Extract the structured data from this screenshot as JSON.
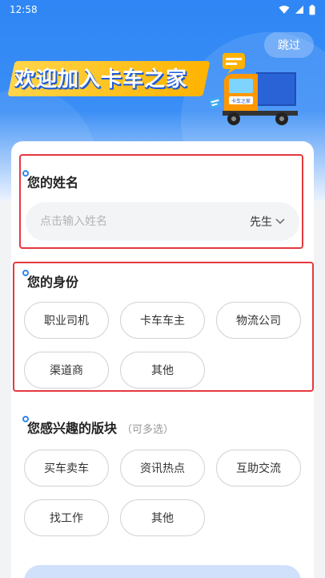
{
  "status": {
    "time": "12:58"
  },
  "header": {
    "skip_label": "跳过",
    "title": "欢迎加入卡车之家",
    "truck_label": "卡车之家"
  },
  "name_section": {
    "title": "您的姓名",
    "placeholder": "点击输入姓名",
    "salutation": "先生"
  },
  "identity_section": {
    "title": "您的身份",
    "options": [
      "职业司机",
      "卡车车主",
      "物流公司",
      "渠道商",
      "其他"
    ]
  },
  "interest_section": {
    "title": "您感兴趣的版块",
    "hint": "（可多选）",
    "options": [
      "买车卖车",
      "资讯热点",
      "互助交流",
      "找工作",
      "其他"
    ]
  },
  "colors": {
    "accent": "#2f86f4",
    "highlight": "#e53940",
    "title_bg": "#ffc107"
  }
}
